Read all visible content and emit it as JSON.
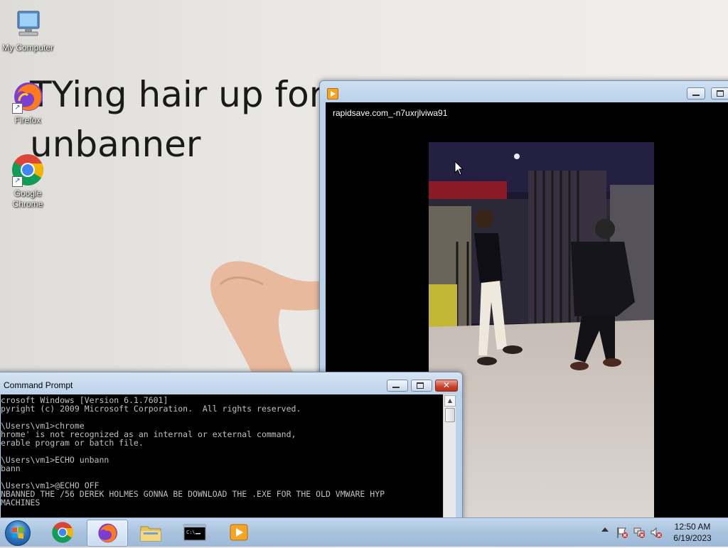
{
  "wallpaper": {
    "title_line1": "TYing hair up for",
    "title_line2": "unbanner"
  },
  "desktop_icons": [
    {
      "label": "My Computer",
      "icon": "computer-icon"
    },
    {
      "label": "Firefox",
      "icon": "firefox-icon"
    },
    {
      "label": "Google Chrome",
      "icon": "chrome-icon"
    }
  ],
  "player": {
    "video_title": "rapidsave.com_-n7uxrjlviwa91",
    "icon": "media-player-icon"
  },
  "cmd": {
    "title": "Command Prompt",
    "lines": [
      "crosoft Windows [Version 6.1.7601]",
      "pyright (c) 2009 Microsoft Corporation.  All rights reserved.",
      "",
      "\\Users\\vm1>chrome",
      "hrome' is not recognized as an internal or external command,",
      "erable program or batch file.",
      "",
      "\\Users\\vm1>ECHO unbann",
      "bann",
      "",
      "\\Users\\vm1>@ECHO OFF",
      "NBANNED THE /56 DEREK HOLMES GONNA BE DOWNLOAD THE .EXE FOR THE OLD VMWARE HYP",
      "MACHINES"
    ],
    "close_glyph": "✕"
  },
  "taskbar": {
    "items": [
      {
        "name": "chrome",
        "icon": "chrome-icon"
      },
      {
        "name": "firefox",
        "icon": "firefox-icon",
        "active": true
      },
      {
        "name": "explorer",
        "icon": "folder-icon"
      },
      {
        "name": "cmd",
        "icon": "terminal-icon"
      },
      {
        "name": "media-player",
        "icon": "media-player-icon"
      }
    ],
    "time": "12:50 AM",
    "date": "6/19/2023"
  }
}
